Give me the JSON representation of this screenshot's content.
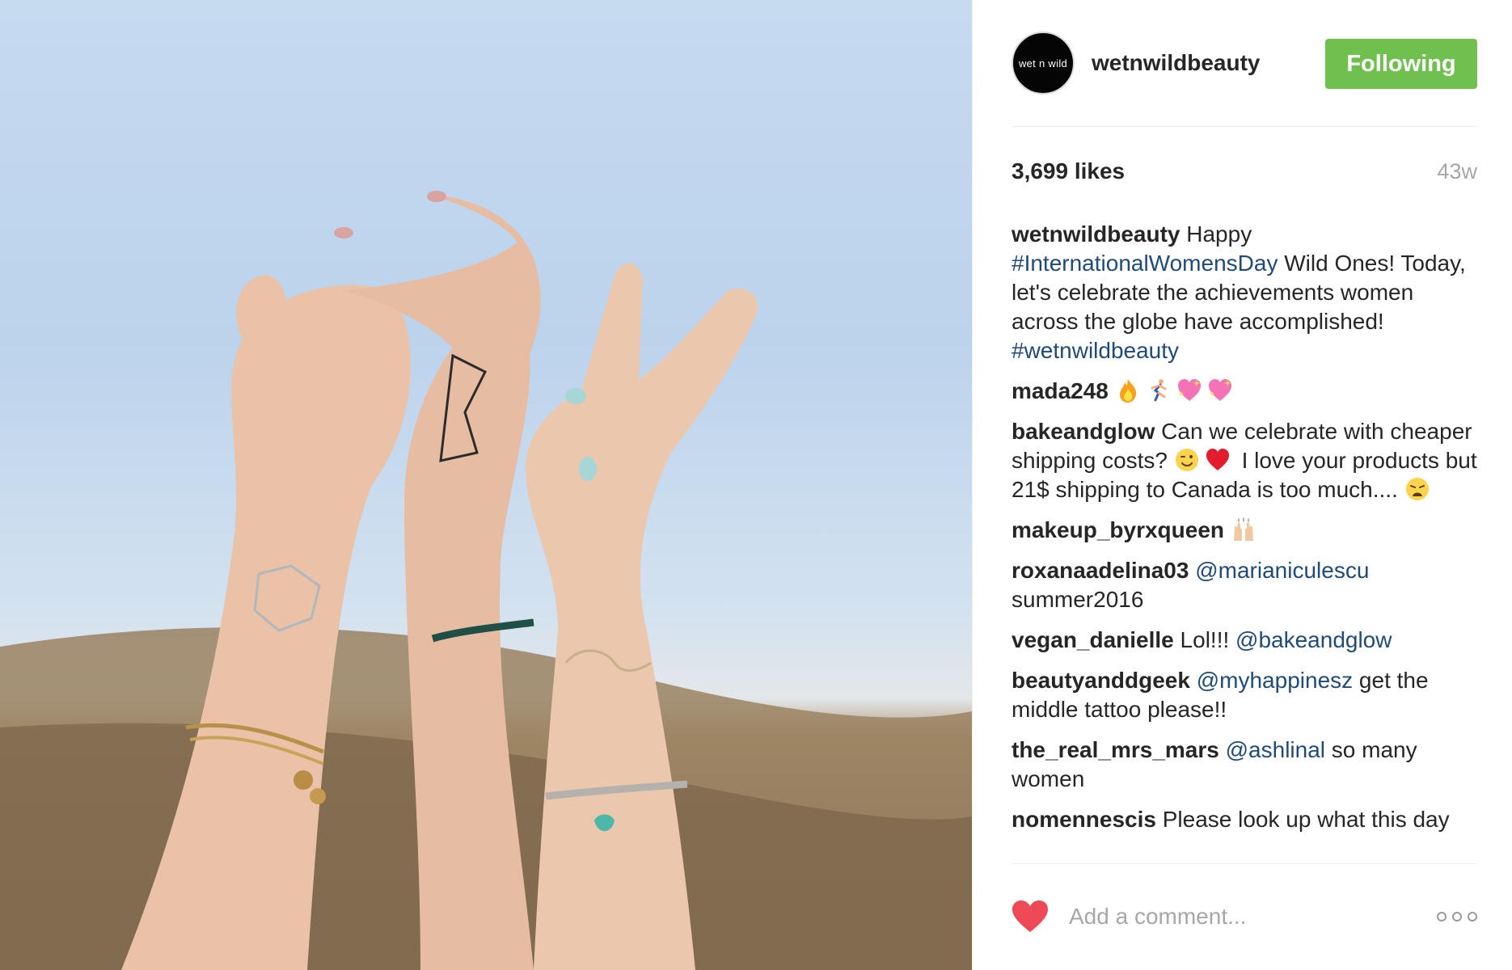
{
  "post": {
    "account": {
      "username": "wetnwildbeauty",
      "avatar_text": "wet n wild",
      "follow_label": "Following",
      "follow_color": "#70c050"
    },
    "likes": "3,699 likes",
    "time": "43w",
    "comments": [
      {
        "user": "wetnwildbeauty",
        "parts": [
          {
            "t": "text",
            "v": "Happy "
          },
          {
            "t": "tag",
            "v": "#InternationalWomensDay"
          },
          {
            "t": "text",
            "v": " Wild Ones! Today, let's celebrate the achievements women across the globe have accomplished! "
          },
          {
            "t": "tag",
            "v": "#wetnwildbeauty"
          }
        ]
      },
      {
        "user": "mada248",
        "parts": [
          {
            "t": "emoji",
            "v": "fire-icon"
          },
          {
            "t": "emoji",
            "v": "runner-icon"
          },
          {
            "t": "emoji",
            "v": "sparkle-heart-icon"
          },
          {
            "t": "emoji",
            "v": "sparkle-heart-icon"
          }
        ]
      },
      {
        "user": "bakeandglow",
        "parts": [
          {
            "t": "text",
            "v": "Can we celebrate with cheaper shipping costs? "
          },
          {
            "t": "emoji",
            "v": "wink-face-icon"
          },
          {
            "t": "emoji",
            "v": "red-heart-icon"
          },
          {
            "t": "text",
            "v": " I love your products but 21$ shipping to Canada is too much.... "
          },
          {
            "t": "emoji",
            "v": "weary-face-icon"
          }
        ]
      },
      {
        "user": "makeup_byrxqueen",
        "parts": [
          {
            "t": "emoji",
            "v": "raised-hands-icon"
          }
        ]
      },
      {
        "user": "roxanaadelina03",
        "parts": [
          {
            "t": "tag",
            "v": "@marianiculescu"
          },
          {
            "t": "text",
            "v": " summer2016"
          }
        ]
      },
      {
        "user": "vegan_danielle",
        "parts": [
          {
            "t": "text",
            "v": "Lol!!! "
          },
          {
            "t": "tag",
            "v": "@bakeandglow"
          }
        ]
      },
      {
        "user": "beautyanddgeek",
        "parts": [
          {
            "t": "tag",
            "v": "@myhappinesz"
          },
          {
            "t": "text",
            "v": " get the middle tattoo please!!"
          }
        ]
      },
      {
        "user": "the_real_mrs_mars",
        "parts": [
          {
            "t": "tag",
            "v": "@ashlinal"
          },
          {
            "t": "text",
            "v": " so many women"
          }
        ]
      },
      {
        "user": "nomennescis",
        "parts": [
          {
            "t": "text",
            "v": "Please look up what this day"
          }
        ]
      }
    ],
    "comment_placeholder": "Add a comment...",
    "like_icon": "heart-icon",
    "like_color": "#ed4956",
    "more_icon": "more-options-icon"
  }
}
